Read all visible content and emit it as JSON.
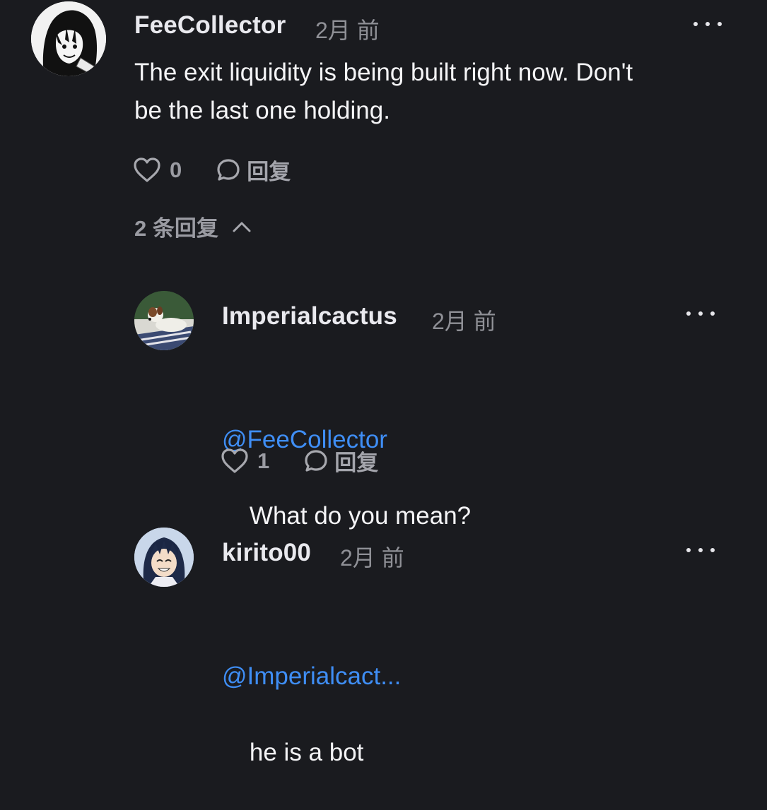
{
  "comments": [
    {
      "author": "FeeCollector",
      "time": "2月 前",
      "text": "The exit liquidity is being built right now. Don't\nbe the last one holding.",
      "likes": "0",
      "reply_label": "回复",
      "replies_toggle": "2 条回复"
    }
  ],
  "replies": [
    {
      "author": "Imperialcactus",
      "time": "2月 前",
      "mention": "@FeeCollector",
      "text": "What do you mean?",
      "likes": "1",
      "reply_label": "回复"
    },
    {
      "author": "kirito00",
      "time": "2月 前",
      "mention": "@Imperialcact...",
      "text": "he is a bot"
    }
  ],
  "icons": {
    "like": "heart-outline-icon",
    "reply": "speech-bubble-icon",
    "more": "more-dots-icon",
    "collapse": "chevron-up-icon"
  },
  "colors": {
    "background": "#1a1b1f",
    "mention": "#3f8ef5",
    "muted": "#8f9096"
  }
}
